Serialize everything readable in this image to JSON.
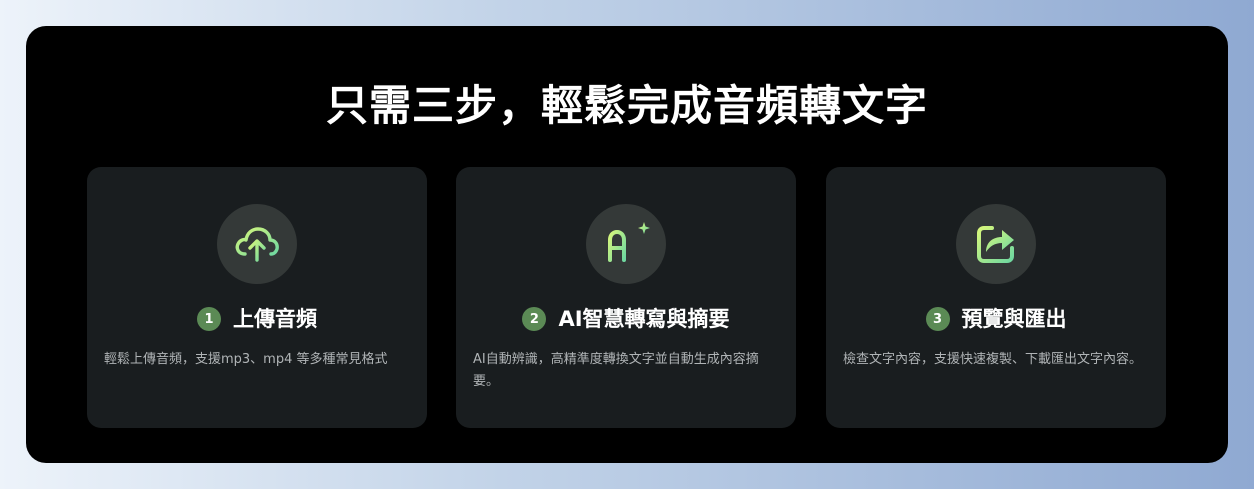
{
  "heading": "只需三步，輕鬆完成音頻轉文字",
  "steps": [
    {
      "number": "1",
      "title": "上傳音頻",
      "description": "輕鬆上傳音頻，支援mp3、mp4 等多種常見格式",
      "icon": "cloud-upload-icon"
    },
    {
      "number": "2",
      "title": "AI智慧轉寫與摘要",
      "description": "AI自動辨識，高精準度轉換文字並自動生成內容摘要。",
      "icon": "ai-sparkle-icon"
    },
    {
      "number": "3",
      "title": "預覽與匯出",
      "description": "檢查文字內容，支援快速複製、下載匯出文字內容。",
      "icon": "share-export-icon"
    }
  ],
  "colors": {
    "panel": "#000000",
    "card": "#191d1f",
    "icon_circle": "#343938",
    "icon_gradient_start": "#d7f77c",
    "icon_gradient_end": "#6fd8a0",
    "step_badge": "#5b8a55"
  }
}
